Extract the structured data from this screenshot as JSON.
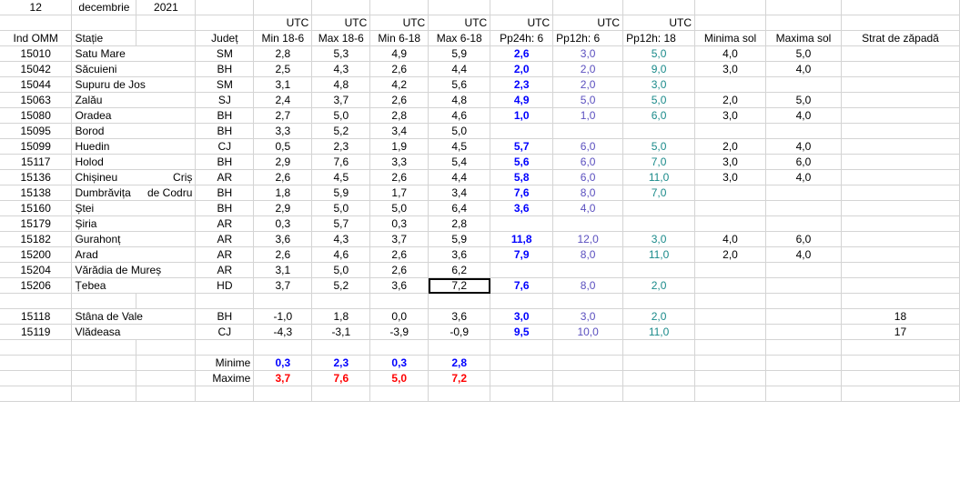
{
  "header": {
    "day": "12",
    "month": "decembrie",
    "year": "2021"
  },
  "utc_label": "UTC",
  "columns": [
    "Ind OMM",
    "Stație",
    "Județ",
    "Min 18-6",
    "Max 18-6",
    "Min 6-18",
    "Max 6-18",
    "Pp24h: 6",
    "Pp12h: 6",
    "Pp12h: 18",
    "Minima sol",
    "Maxima sol",
    "Strat de zăpadă"
  ],
  "rows": [
    {
      "id": "15010",
      "name": "Satu Mare",
      "name2": "",
      "jud": "SM",
      "min186": "2,8",
      "max186": "5,3",
      "min618": "4,9",
      "max618": "5,9",
      "pp24": "2,6",
      "pp12a": "3,0",
      "pp12b": "5,0",
      "minsol": "4,0",
      "maxsol": "5,0",
      "snow": ""
    },
    {
      "id": "15042",
      "name": "Săcuieni",
      "name2": "",
      "jud": "BH",
      "min186": "2,5",
      "max186": "4,3",
      "min618": "2,6",
      "max618": "4,4",
      "pp24": "2,0",
      "pp12a": "2,0",
      "pp12b": "9,0",
      "minsol": "3,0",
      "maxsol": "4,0",
      "snow": ""
    },
    {
      "id": "15044",
      "name": "Supuru de Jos",
      "name2": "",
      "jud": "SM",
      "min186": "3,1",
      "max186": "4,8",
      "min618": "4,2",
      "max618": "5,6",
      "pp24": "2,3",
      "pp12a": "2,0",
      "pp12b": "3,0",
      "minsol": "",
      "maxsol": "",
      "snow": ""
    },
    {
      "id": "15063",
      "name": "Zalău",
      "name2": "",
      "jud": "SJ",
      "min186": "2,4",
      "max186": "3,7",
      "min618": "2,6",
      "max618": "4,8",
      "pp24": "4,9",
      "pp12a": "5,0",
      "pp12b": "5,0",
      "minsol": "2,0",
      "maxsol": "5,0",
      "snow": ""
    },
    {
      "id": "15080",
      "name": "Oradea",
      "name2": "",
      "jud": "BH",
      "min186": "2,7",
      "max186": "5,0",
      "min618": "2,8",
      "max618": "4,6",
      "pp24": "1,0",
      "pp12a": "1,0",
      "pp12b": "6,0",
      "minsol": "3,0",
      "maxsol": "4,0",
      "snow": ""
    },
    {
      "id": "15095",
      "name": "Borod",
      "name2": "",
      "jud": "BH",
      "min186": "3,3",
      "max186": "5,2",
      "min618": "3,4",
      "max618": "5,0",
      "pp24": "",
      "pp12a": "",
      "pp12b": "",
      "minsol": "",
      "maxsol": "",
      "snow": ""
    },
    {
      "id": "15099",
      "name": "Huedin",
      "name2": "",
      "jud": "CJ",
      "min186": "0,5",
      "max186": "2,3",
      "min618": "1,9",
      "max618": "4,5",
      "pp24": "5,7",
      "pp12a": "6,0",
      "pp12b": "5,0",
      "minsol": "2,0",
      "maxsol": "4,0",
      "snow": ""
    },
    {
      "id": "15117",
      "name": "Holod",
      "name2": "",
      "jud": "BH",
      "min186": "2,9",
      "max186": "7,6",
      "min618": "3,3",
      "max618": "5,4",
      "pp24": "5,6",
      "pp12a": "6,0",
      "pp12b": "7,0",
      "minsol": "3,0",
      "maxsol": "6,0",
      "snow": ""
    },
    {
      "id": "15136",
      "name": "Chișineu",
      "name2": "Criș",
      "jud": "AR",
      "min186": "2,6",
      "max186": "4,5",
      "min618": "2,6",
      "max618": "4,4",
      "pp24": "5,8",
      "pp12a": "6,0",
      "pp12b": "11,0",
      "minsol": "3,0",
      "maxsol": "4,0",
      "snow": ""
    },
    {
      "id": "15138",
      "name": "Dumbrăvița",
      "name2": "de Codru",
      "jud": "BH",
      "min186": "1,8",
      "max186": "5,9",
      "min618": "1,7",
      "max618": "3,4",
      "pp24": "7,6",
      "pp12a": "8,0",
      "pp12b": "7,0",
      "minsol": "",
      "maxsol": "",
      "snow": ""
    },
    {
      "id": "15160",
      "name": "Ștei",
      "name2": "",
      "jud": "BH",
      "min186": "2,9",
      "max186": "5,0",
      "min618": "5,0",
      "max618": "6,4",
      "pp24": "3,6",
      "pp12a": "4,0",
      "pp12b": "",
      "minsol": "",
      "maxsol": "",
      "snow": ""
    },
    {
      "id": "15179",
      "name": "Șiria",
      "name2": "",
      "jud": "AR",
      "min186": "0,3",
      "max186": "5,7",
      "min618": "0,3",
      "max618": "2,8",
      "pp24": "",
      "pp12a": "",
      "pp12b": "",
      "minsol": "",
      "maxsol": "",
      "snow": ""
    },
    {
      "id": "15182",
      "name": "Gurahonț",
      "name2": "",
      "jud": "AR",
      "min186": "3,6",
      "max186": "4,3",
      "min618": "3,7",
      "max618": "5,9",
      "pp24": "11,8",
      "pp12a": "12,0",
      "pp12b": "3,0",
      "minsol": "4,0",
      "maxsol": "6,0",
      "snow": ""
    },
    {
      "id": "15200",
      "name": "Arad",
      "name2": "",
      "jud": "AR",
      "min186": "2,6",
      "max186": "4,6",
      "min618": "2,6",
      "max618": "3,6",
      "pp24": "7,9",
      "pp12a": "8,0",
      "pp12b": "11,0",
      "minsol": "2,0",
      "maxsol": "4,0",
      "snow": ""
    },
    {
      "id": "15204",
      "name": "Vărădia de Mureș",
      "name2": "",
      "jud": "AR",
      "min186": "3,1",
      "max186": "5,0",
      "min618": "2,6",
      "max618": "6,2",
      "pp24": "",
      "pp12a": "",
      "pp12b": "",
      "minsol": "",
      "maxsol": "",
      "snow": ""
    },
    {
      "id": "15206",
      "name": "Țebea",
      "name2": "",
      "jud": "HD",
      "min186": "3,7",
      "max186": "5,2",
      "min618": "3,6",
      "max618": "7,2",
      "pp24": "7,6",
      "pp12a": "8,0",
      "pp12b": "2,0",
      "minsol": "",
      "maxsol": "",
      "snow": ""
    }
  ],
  "rows2": [
    {
      "id": "15118",
      "name": "Stâna de Vale",
      "name2": "",
      "jud": "BH",
      "min186": "-1,0",
      "max186": "1,8",
      "min618": "0,0",
      "max618": "3,6",
      "pp24": "3,0",
      "pp12a": "3,0",
      "pp12b": "2,0",
      "minsol": "",
      "maxsol": "",
      "snow": "18"
    },
    {
      "id": "15119",
      "name": "Vlădeasa",
      "name2": "",
      "jud": "CJ",
      "min186": "-4,3",
      "max186": "-3,1",
      "min618": "-3,9",
      "max618": "-0,9",
      "pp24": "9,5",
      "pp12a": "10,0",
      "pp12b": "11,0",
      "minsol": "",
      "maxsol": "",
      "snow": "17"
    }
  ],
  "summary": {
    "min_label": "Minime",
    "min": [
      "0,3",
      "2,3",
      "0,3",
      "2,8"
    ],
    "max_label": "Maxime",
    "max": [
      "3,7",
      "7,6",
      "5,0",
      "7,2"
    ]
  },
  "colors": {
    "bold_blue": "#0000ff",
    "purple": "#5a4fbf",
    "teal": "#1a8a8a",
    "red": "#ff0000",
    "grid": "#d4d4d4"
  },
  "selected_cell": "max618 of 15206"
}
